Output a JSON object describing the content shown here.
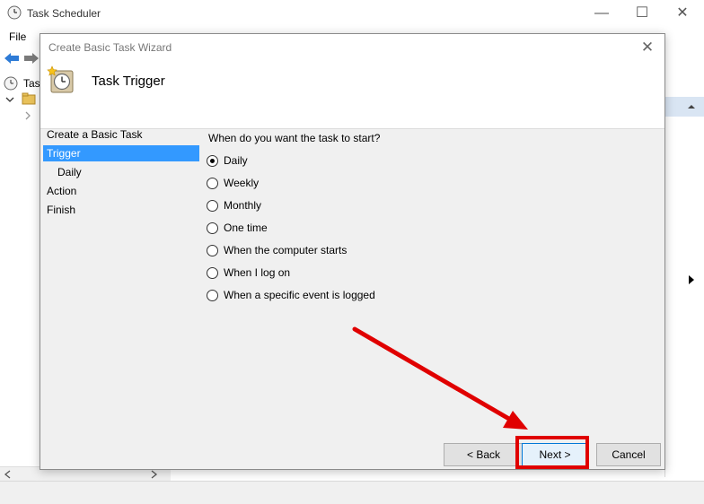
{
  "background_window": {
    "title": "Task Scheduler",
    "menu": {
      "file": "File"
    },
    "tree_label": "Tas",
    "controls": {
      "minimize": "—",
      "maximize": "☐",
      "close": "✕"
    }
  },
  "wizard": {
    "title": "Create Basic Task Wizard",
    "close_glyph": "✕",
    "header_title": "Task Trigger",
    "steps": [
      {
        "label": "Create a Basic Task",
        "active": false
      },
      {
        "label": "Trigger",
        "active": true
      },
      {
        "label": "Daily",
        "active": false
      },
      {
        "label": "Action",
        "active": false
      },
      {
        "label": "Finish",
        "active": false
      }
    ],
    "question": "When do you want the task to start?",
    "options": [
      {
        "label": "Daily",
        "checked": true
      },
      {
        "label": "Weekly",
        "checked": false
      },
      {
        "label": "Monthly",
        "checked": false
      },
      {
        "label": "One time",
        "checked": false
      },
      {
        "label": "When the computer starts",
        "checked": false
      },
      {
        "label": "When I log on",
        "checked": false
      },
      {
        "label": "When a specific event is logged",
        "checked": false
      }
    ],
    "buttons": {
      "back": "< Back",
      "next": "Next >",
      "cancel": "Cancel"
    }
  },
  "colors": {
    "selection_blue": "#3399ff",
    "annotation_red": "#e00000"
  }
}
